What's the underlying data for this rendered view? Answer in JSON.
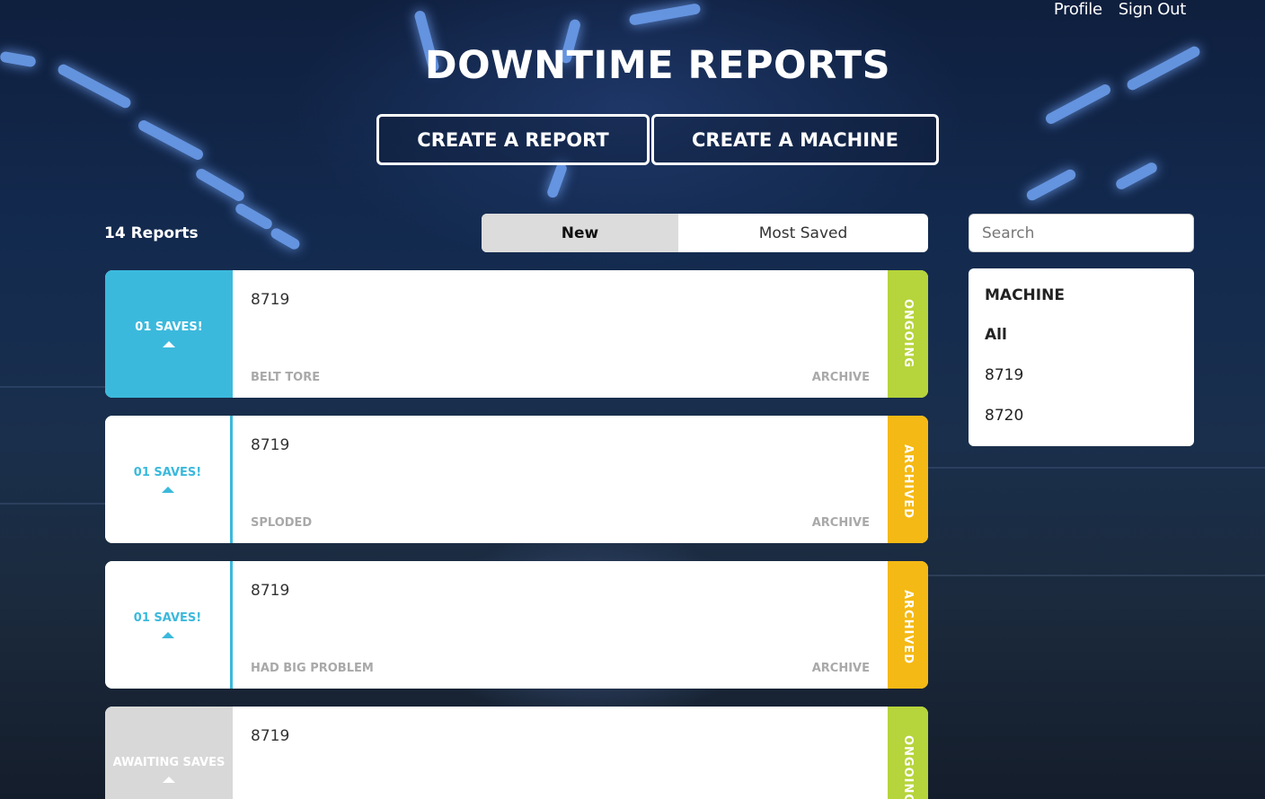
{
  "nav": {
    "profile": "Profile",
    "sign_out": "Sign Out"
  },
  "page_title": "DOWNTIME REPORTS",
  "actions": {
    "create_report": "CREATE A REPORT",
    "create_machine": "CREATE A MACHINE"
  },
  "report_count": "14 Reports",
  "sort": {
    "options": [
      "New",
      "Most Saved"
    ],
    "active": "New"
  },
  "search": {
    "placeholder": "Search",
    "value": ""
  },
  "filter": {
    "heading": "MACHINE",
    "items": [
      "All",
      "8719",
      "8720"
    ],
    "selected": "All"
  },
  "reports": [
    {
      "saves": "01 SAVES!",
      "machine": "8719",
      "description": "BELT TORE",
      "archive_label": "ARCHIVE",
      "status": "ONGOING",
      "status_color": "#b6d43b",
      "saves_style": "highlight"
    },
    {
      "saves": "01 SAVES!",
      "machine": "8719",
      "description": "SPLODED",
      "archive_label": "ARCHIVE",
      "status": "ARCHIVED",
      "status_color": "#f4b914",
      "saves_style": "plain"
    },
    {
      "saves": "01 SAVES!",
      "machine": "8719",
      "description": "HAD BIG PROBLEM",
      "archive_label": "ARCHIVE",
      "status": "ARCHIVED",
      "status_color": "#f4b914",
      "saves_style": "plain"
    },
    {
      "saves": "AWAITING SAVES",
      "machine": "8719",
      "description": "",
      "archive_label": "",
      "status": "ONGOING",
      "status_color": "#b6d43b",
      "saves_style": "awaiting"
    }
  ],
  "colors": {
    "accent": "#3bb9dc",
    "ongoing": "#b6d43b",
    "archived": "#f4b914"
  }
}
